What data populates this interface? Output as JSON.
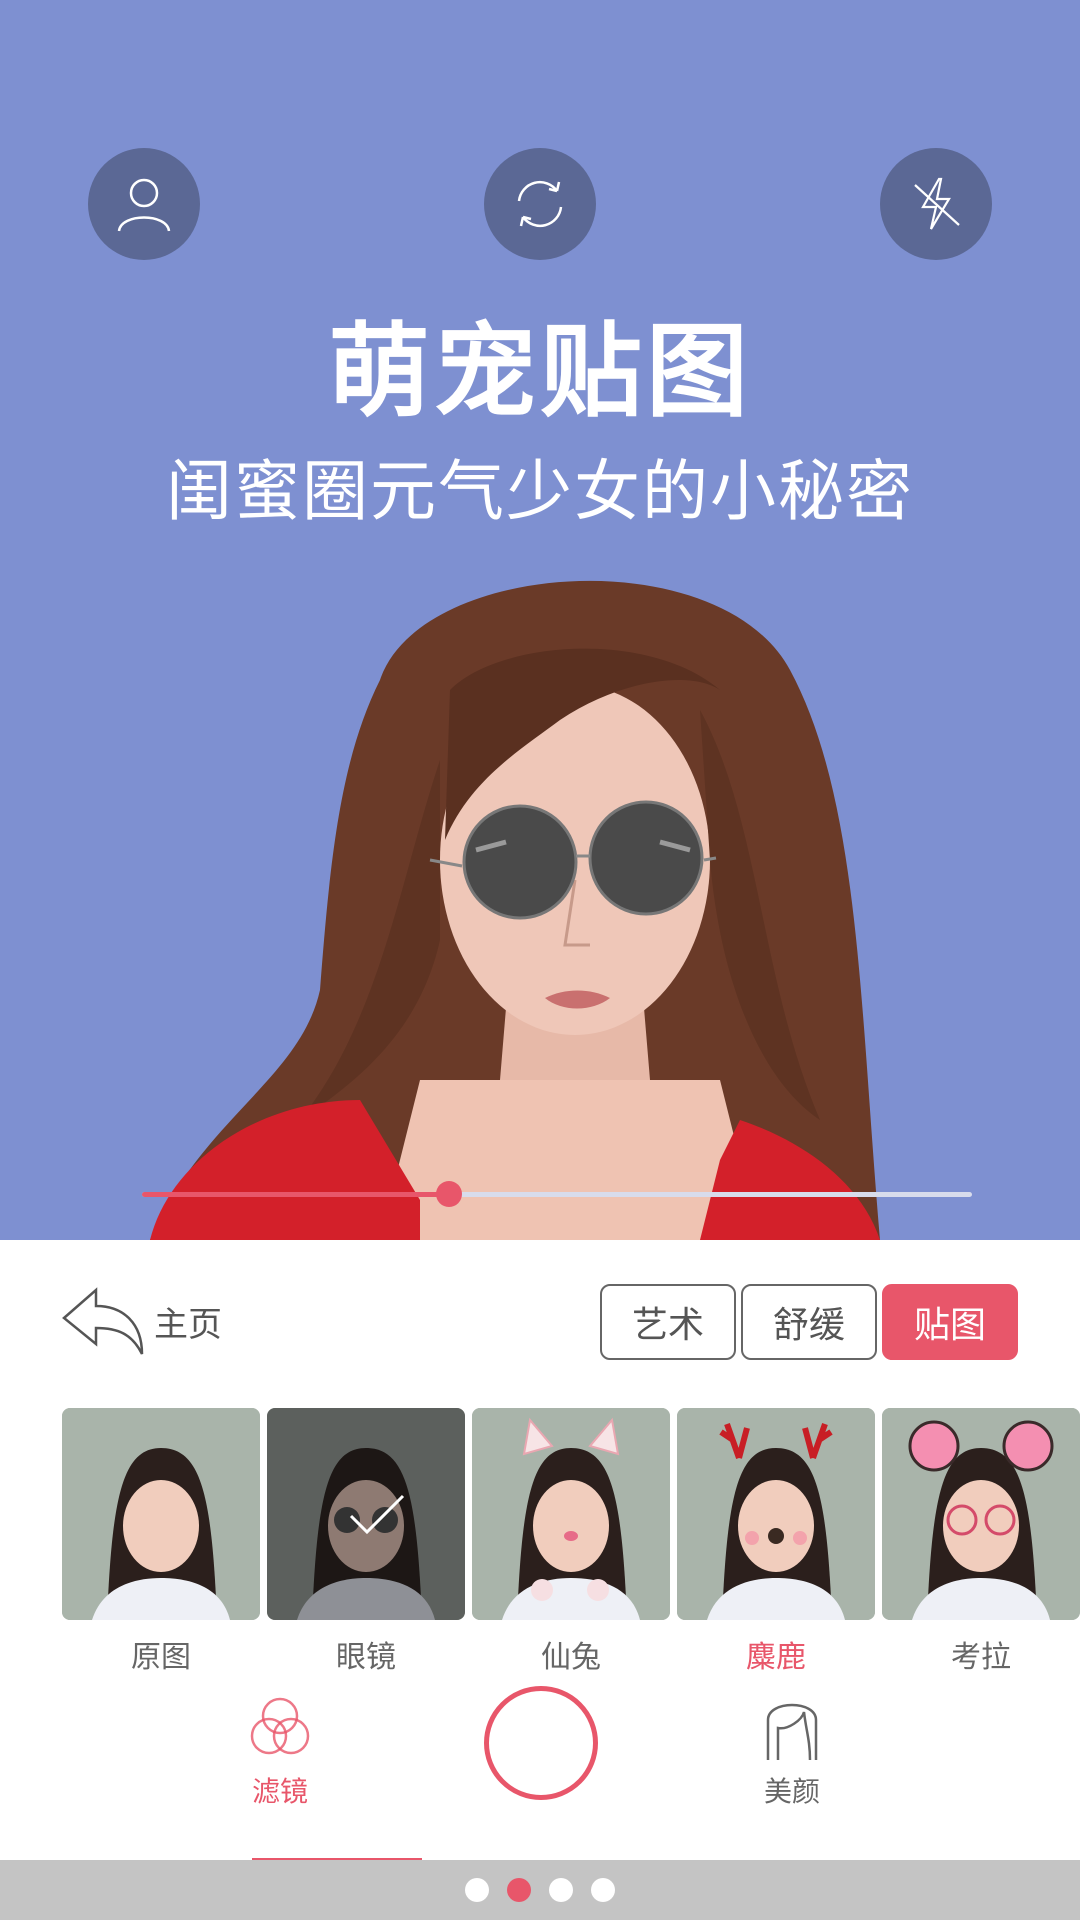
{
  "header": {
    "title": "萌宠贴图",
    "subtitle": "闺蜜圈元气少女的小秘密",
    "buttons": [
      {
        "icon": "profile-icon"
      },
      {
        "icon": "switch-camera-icon"
      },
      {
        "icon": "flash-off-icon"
      }
    ]
  },
  "slider": {
    "value": 0.37
  },
  "panel": {
    "home_label": "主页",
    "tabs": [
      "艺术",
      "舒缓",
      "贴图"
    ],
    "active_tab": "贴图",
    "stickers": [
      {
        "label": "原图",
        "selected": false
      },
      {
        "label": "眼镜",
        "checked": true
      },
      {
        "label": "仙兔"
      },
      {
        "label": "麋鹿",
        "selected": true
      },
      {
        "label": "考拉"
      }
    ]
  },
  "nav": {
    "filter_label": "滤镜",
    "beauty_label": "美颜"
  },
  "pager": {
    "count": 4,
    "active": 1
  },
  "colors": {
    "hero_bg": "#7e90d1",
    "accent": "#e8566a",
    "button_bg": "#5b6895"
  }
}
